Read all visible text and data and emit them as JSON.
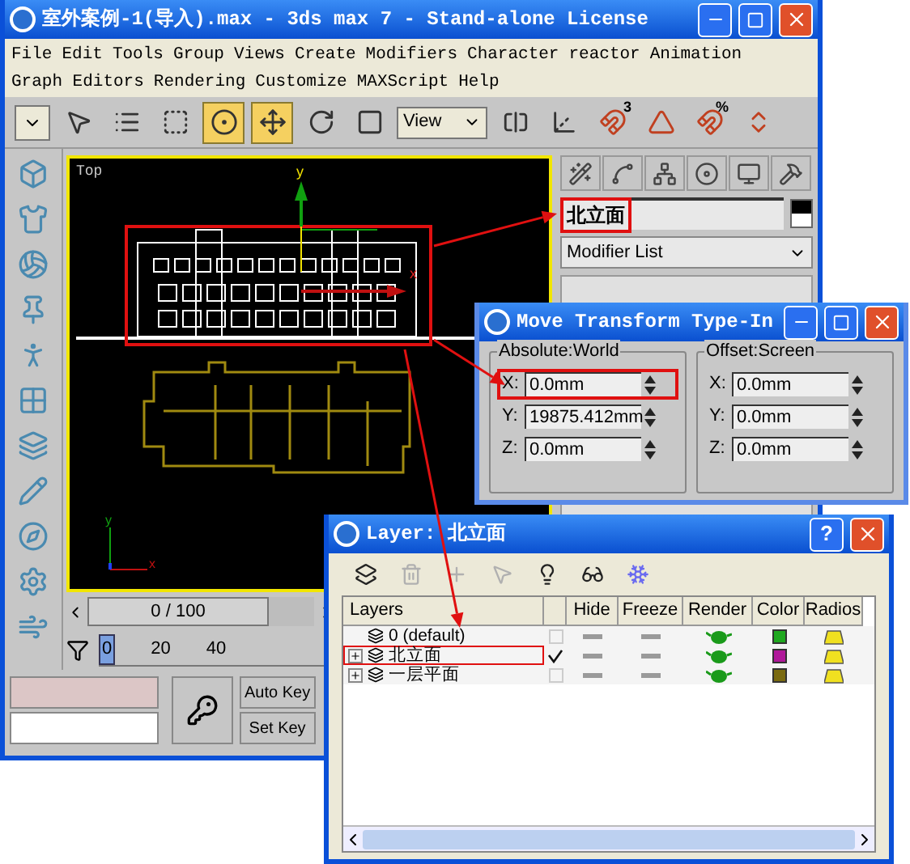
{
  "main_window": {
    "title": "室外案例-1(导入).max - 3ds max 7  - Stand-alone License",
    "menu_rows": [
      [
        "File",
        "Edit",
        "Tools",
        "Group",
        "Views",
        "Create",
        "Modifiers",
        "Character",
        "reactor",
        "Animation"
      ],
      [
        "Graph Editors",
        "Rendering",
        "Customize",
        "MAXScript",
        "Help"
      ]
    ],
    "toolbar": [
      {
        "kind": "filter-dropdown",
        "active": false
      },
      {
        "kind": "select",
        "active": false
      },
      {
        "kind": "select-by-name",
        "active": false
      },
      {
        "kind": "region",
        "active": false
      },
      {
        "kind": "crossing",
        "active": true
      },
      {
        "kind": "move",
        "active": true
      },
      {
        "kind": "rotate",
        "active": false
      },
      {
        "kind": "scale",
        "active": false
      },
      {
        "kind": "reference",
        "label": "View",
        "active": false
      },
      {
        "kind": "pivot",
        "active": false
      },
      {
        "kind": "axis",
        "active": false
      },
      {
        "kind": "snap",
        "badge": "3",
        "active": false
      },
      {
        "kind": "angle-snap",
        "active": false
      },
      {
        "kind": "percent-snap",
        "badge": "%",
        "active": false
      },
      {
        "kind": "spinner-snap",
        "active": false
      }
    ],
    "viewport": {
      "label": "Top",
      "gizmo_axis_labels": [
        "y",
        "x"
      ],
      "corner_axis_labels": [
        "y",
        "x"
      ]
    },
    "command_panel": {
      "tabs": [
        {
          "kind": "create"
        },
        {
          "kind": "modify"
        },
        {
          "kind": "hierarchy"
        },
        {
          "kind": "motion"
        },
        {
          "kind": "display"
        },
        {
          "kind": "utilities"
        }
      ],
      "object_name": {
        "value": "北立面",
        "highlighted": true
      },
      "modifier_list": "Modifier List"
    },
    "time_slider": {
      "label": "0 / 100",
      "level": 0
    },
    "track_bar": {
      "current_frame": "0",
      "tick_labels": [
        "20",
        "40"
      ]
    },
    "animation_keys": {
      "auto_key": "Auto Key",
      "set_key": "Set Key"
    }
  },
  "move_dialog": {
    "title": "Move Transform Type-In",
    "groups": [
      {
        "title": "Absolute:World",
        "fields": [
          {
            "label": "X:",
            "value": "0.0mm",
            "highlighted": true
          },
          {
            "label": "Y:",
            "value": "19875.412mm",
            "highlighted": false
          },
          {
            "label": "Z:",
            "value": "0.0mm",
            "highlighted": false
          }
        ]
      },
      {
        "title": "Offset:Screen",
        "fields": [
          {
            "label": "X:",
            "value": "0.0mm",
            "highlighted": false
          },
          {
            "label": "Y:",
            "value": "0.0mm",
            "highlighted": false
          },
          {
            "label": "Z:",
            "value": "0.0mm",
            "highlighted": false
          }
        ]
      }
    ]
  },
  "layer_dialog": {
    "title": "Layer: 北立面",
    "help_button": "?",
    "toolbar": [
      {
        "kind": "new-layer",
        "disabled": false
      },
      {
        "kind": "delete",
        "disabled": true
      },
      {
        "kind": "add",
        "disabled": true
      },
      {
        "kind": "select",
        "disabled": true
      },
      {
        "kind": "highlight",
        "disabled": false
      },
      {
        "kind": "hide",
        "disabled": false
      },
      {
        "kind": "freeze",
        "disabled": false
      }
    ],
    "columns": [
      "Layers",
      "Hide",
      "Freeze",
      "Render",
      "Color",
      "Radios"
    ],
    "rows": [
      {
        "name": "0 (default)",
        "expandable": false,
        "current": false,
        "hidden": false,
        "frozen": false,
        "color": "#1fa81f",
        "highlighted": false
      },
      {
        "name": "北立面",
        "expandable": true,
        "current": true,
        "hidden": false,
        "frozen": false,
        "color": "#b0189a",
        "highlighted": true
      },
      {
        "name": "一层平面",
        "expandable": true,
        "current": false,
        "hidden": false,
        "frozen": false,
        "color": "#7a6a10",
        "highlighted": false
      }
    ]
  }
}
